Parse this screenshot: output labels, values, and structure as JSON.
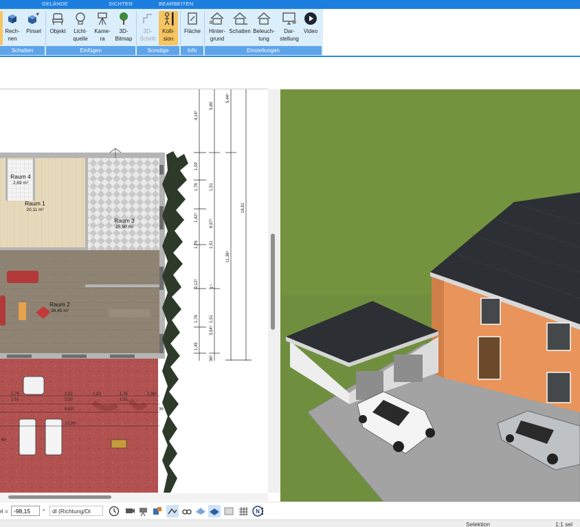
{
  "ribbon": {
    "tabs": [
      "GELÄNDE",
      "SICHTEN",
      "BEARBEITEN"
    ],
    "groups": {
      "schatten": "Schatten",
      "einfuegen": "Einfügen",
      "sonstige": "Sonstige",
      "info": "Info",
      "einstellungen": "Einstellungen"
    },
    "buttons": {
      "rechnen": [
        "Rech-",
        "nen"
      ],
      "pinsel": "Pinsel",
      "objekt": "Objekt",
      "lichtquelle": [
        "Licht-",
        "quelle"
      ],
      "kamera": [
        "Kame-",
        "ra"
      ],
      "bitmap": [
        "3D-",
        "Bitmap"
      ],
      "schritt": [
        "3D-",
        "Schritt"
      ],
      "kollision": [
        "Kolli-",
        "sion"
      ],
      "flaeche": "Fläche",
      "hintergrund": [
        "Hinter-",
        "grund"
      ],
      "schatten": "Schatten",
      "beleuchtung": [
        "Beleuch-",
        "tung"
      ],
      "darstellung": [
        "Dar-",
        "stellung"
      ],
      "video": "Video"
    }
  },
  "plan": {
    "rooms": [
      {
        "name": "Raum 4",
        "area": "2,69 m²"
      },
      {
        "name": "Raum 1",
        "area": "20,11 m²"
      },
      {
        "name": "Raum 3",
        "area": "25,90 m²"
      },
      {
        "name": "Raum 2",
        "area": "36,45 m²"
      }
    ],
    "dims_vertical": [
      "4,14⁵",
      "5,89",
      "5,44⁵",
      "1,09",
      "1,76",
      "1,51",
      "1,42⁵",
      "6,97⁵",
      "16,81",
      "1,76",
      "1,51",
      "11,36⁵",
      "2,12⁵",
      "1⁰",
      "1,76",
      "1,51",
      "3,54⁵",
      "1,45",
      "36⁵"
    ],
    "dims_horizontal_row1": [
      "1,76",
      "2,02",
      "1,10",
      "1,76",
      "1,36⁵"
    ],
    "dims_horizontal_row2": [
      "1,51",
      "2,20",
      "1,51"
    ],
    "dims_other": [
      "9,63⁵",
      "10,36⁵",
      "36",
      "60"
    ]
  },
  "toolbar": {
    "left_label": "el =",
    "angle_value": "-98,15",
    "degree": "°",
    "direction_select": "dl (Richtung/Di",
    "icons": [
      "clock-icon",
      "camera-icon",
      "camera-3d-icon",
      "material-icon",
      "walk-icon",
      "binoculars-icon",
      "fly-icon",
      "surface-icon",
      "texture-icon",
      "grid-icon",
      "north-icon",
      "more-icon"
    ]
  },
  "status": {
    "mode": "Selektion",
    "selection": "1:1 sel"
  },
  "colors": {
    "ribbon_tabbar": "#1c7fe0",
    "ribbon_bg": "#dbeefb",
    "ribbon_group_bar": "#5da4ea",
    "active_button": "#f6c460",
    "grass": "#6f8f3f",
    "plaster_orange": "#e8945a",
    "roof": "#2c3034"
  }
}
